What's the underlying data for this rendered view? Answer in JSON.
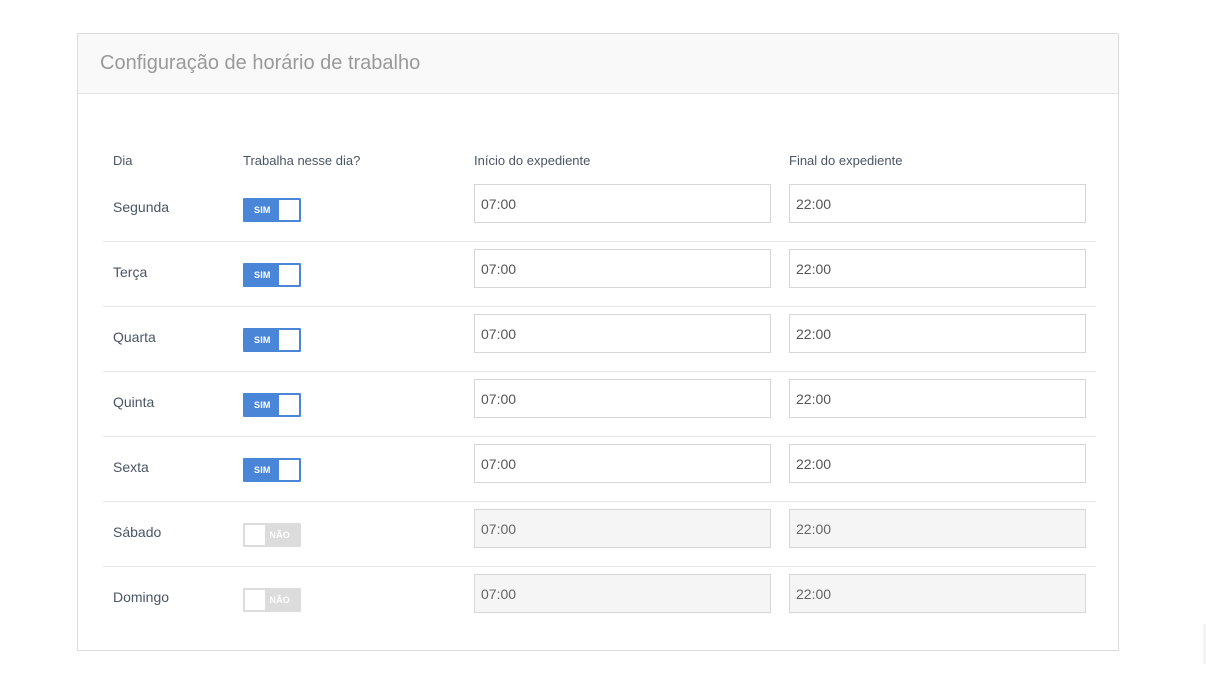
{
  "panel": {
    "title": "Configuração de horário de trabalho"
  },
  "headers": {
    "dia": "Dia",
    "trabalha": "Trabalha nesse dia?",
    "inicio": "Início do expediente",
    "final": "Final do expediente"
  },
  "rows": [
    {
      "day": "Segunda",
      "toggle": "SIM",
      "on": true,
      "start": "07:00",
      "end": "22:00"
    },
    {
      "day": "Terça",
      "toggle": "SIM",
      "on": true,
      "start": "07:00",
      "end": "22:00"
    },
    {
      "day": "Quarta",
      "toggle": "SIM",
      "on": true,
      "start": "07:00",
      "end": "22:00"
    },
    {
      "day": "Quinta",
      "toggle": "SIM",
      "on": true,
      "start": "07:00",
      "end": "22:00"
    },
    {
      "day": "Sexta",
      "toggle": "SIM",
      "on": true,
      "start": "07:00",
      "end": "22:00"
    },
    {
      "day": "Sábado",
      "toggle": "NÃO",
      "on": false,
      "start": "07:00",
      "end": "22:00"
    },
    {
      "day": "Domingo",
      "toggle": "NÃO",
      "on": false,
      "start": "07:00",
      "end": "22:00"
    }
  ],
  "colors": {
    "toggle_on": "#4a86d8",
    "toggle_off": "#dcdcdc"
  }
}
